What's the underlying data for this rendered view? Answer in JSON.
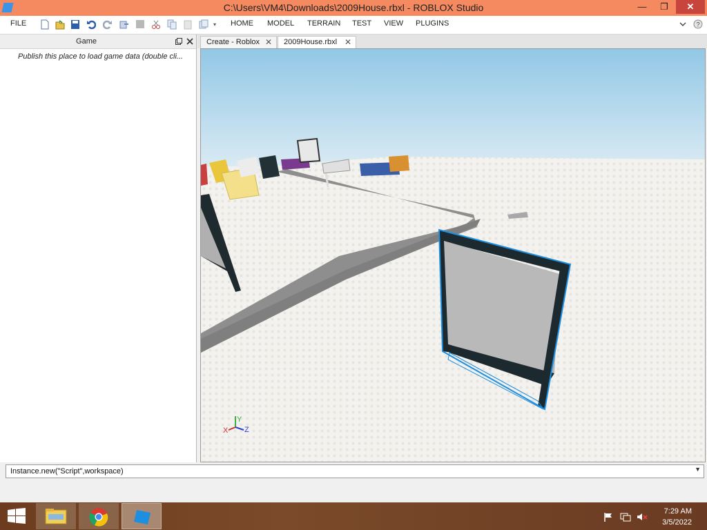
{
  "window": {
    "title": "C:\\Users\\VM4\\Downloads\\2009House.rbxl - ROBLOX Studio",
    "minimize": "—",
    "restore": "❐",
    "close": "✕"
  },
  "menu": {
    "file": "FILE",
    "tabs": [
      "HOME",
      "MODEL",
      "TERRAIN",
      "TEST",
      "VIEW",
      "PLUGINS"
    ]
  },
  "panel": {
    "title": "Game",
    "message": "Publish this place to load game data (double cli..."
  },
  "doc_tabs": [
    {
      "label": "Create - Roblox"
    },
    {
      "label": "2009House.rbxl"
    }
  ],
  "gizmo": {
    "x": "X",
    "y": "Y",
    "z": "Z"
  },
  "command_bar": {
    "value": "Instance.new(\"Script\",workspace)"
  },
  "clock": {
    "time": "7:29 AM",
    "date": "3/5/2022"
  },
  "colors": {
    "titlebar": "#f5895f",
    "selection": "#1e8fe0"
  }
}
